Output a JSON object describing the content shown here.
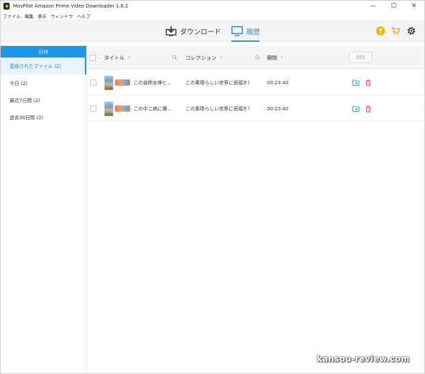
{
  "window": {
    "title": "MovPilot Amazon Prime Video Downloader 1.6.2",
    "controls": {
      "minimize": "—",
      "maximize": "☐",
      "close": "✕"
    }
  },
  "menu": [
    "ファイル",
    "編集",
    "表示",
    "ウィンドウ",
    "ヘルプ"
  ],
  "nav": {
    "download_label": "ダウンロード",
    "history_label": "履歴",
    "active_tab": "history",
    "accent_color": "#2a93d8"
  },
  "toolbar_icons": [
    "key-icon",
    "cart-icon",
    "gear-icon"
  ],
  "sidebar": {
    "header": "日付",
    "items": [
      {
        "label": "変換されたファイル (2)",
        "active": true
      },
      {
        "label": "今日 (2)",
        "active": false
      },
      {
        "label": "最近7日間 (2)",
        "active": false
      },
      {
        "label": "過去30日間 (2)",
        "active": false
      }
    ]
  },
  "table": {
    "columns": {
      "title": "タイトル",
      "collection": "コレクション",
      "duration": "期間"
    },
    "delete_button": "削除",
    "rows": [
      {
        "title": "この自称女神と...",
        "collection": "この素晴らしい世界に祝福を！",
        "duration": "00:23:40"
      },
      {
        "title": "この中二病に爆...",
        "collection": "この素晴らしい世界に祝福を！",
        "duration": "00:23:40"
      }
    ]
  },
  "watermark": "kansou-review.com"
}
